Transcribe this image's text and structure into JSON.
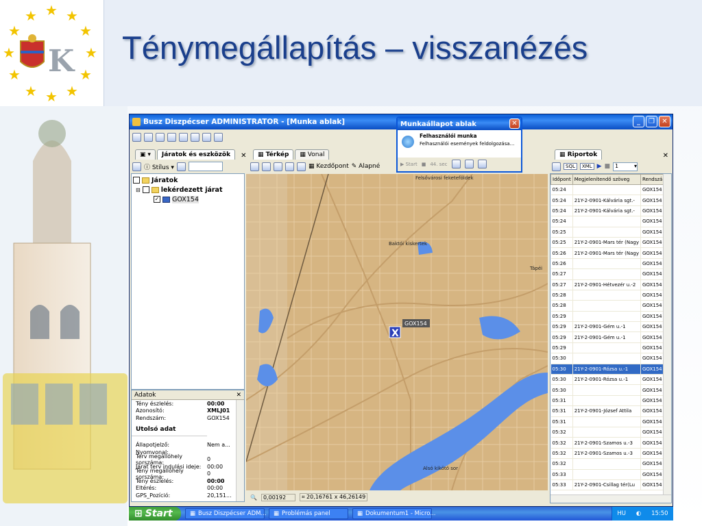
{
  "slide": {
    "title": "Ténymegállapítás – visszanézés",
    "logo_text": "K"
  },
  "app": {
    "window_title": "Busz Diszpécser ADMINISTRATOR - [Munka ablak]",
    "left_tabs": [
      "Járatok és eszközök"
    ],
    "left_toolbar": {
      "style_label": "Stílus"
    },
    "tree": {
      "root": "Járatok",
      "child": "lekérdezett járat",
      "vehicle": "GOX154"
    },
    "data_panel": {
      "title": "Adatok",
      "rows_top": [
        {
          "k": "Tény észlelés:",
          "v": "00:00"
        },
        {
          "k": "Azonosító:",
          "v": "XMLJ01"
        },
        {
          "k": "Rendszám:",
          "v": "GOX154"
        }
      ],
      "section": "Utolsó adat",
      "rows_bottom": [
        {
          "k": "Állapotjelző:",
          "v": "Nem a..."
        },
        {
          "k": "Nyomvonal:",
          "v": ""
        },
        {
          "k": "Terv megállóhely sorszáma:",
          "v": "0"
        },
        {
          "k": "Járat terv indulási ideje:",
          "v": "00:00"
        },
        {
          "k": "Tény megállóhely sorszáma:",
          "v": "0"
        },
        {
          "k": "Tény észlelés:",
          "v": "00:00"
        },
        {
          "k": "Eltérés:",
          "v": "00:00"
        },
        {
          "k": "GPS_Pozíció:",
          "v": "20,151..."
        }
      ]
    },
    "map_tabs": [
      "Térkép",
      "Vonal"
    ],
    "map_toolbar": {
      "start_point": "Kezdőpont",
      "base": "Alapné"
    },
    "map_labels": {
      "top": "Felsővárosi feketeföldek",
      "garden": "Baktói kiskertek",
      "east": "Tápéi",
      "bottom": "Alsó kikötő sor",
      "vehicle": "GOX154",
      "marker": "X"
    },
    "map_status": {
      "scale": "0,00192",
      "coords": "20,16761 x 46,26149"
    },
    "report": {
      "tab": "Riportok",
      "toolbar": {
        "sql": "SQL",
        "xml": "XML",
        "page": "1"
      },
      "columns": [
        "Időpont",
        "Megjelenítendő szöveg",
        "Rendszám"
      ],
      "rows": [
        [
          "05:24",
          "",
          "GOX154"
        ],
        [
          "05:24",
          "21Y-2-0901-Kálvária sgt.-",
          "GOX154"
        ],
        [
          "05:24",
          "21Y-2-0901-Kálvária sgt.-",
          "GOX154"
        ],
        [
          "05:24",
          "",
          "GOX154"
        ],
        [
          "05:25",
          "",
          "GOX154"
        ],
        [
          "05:25",
          "21Y-2-0901-Mars tér (Nagy",
          "GOX154"
        ],
        [
          "05:26",
          "21Y-2-0901-Mars tér (Nagy",
          "GOX154"
        ],
        [
          "05:26",
          "",
          "GOX154"
        ],
        [
          "05:27",
          "",
          "GOX154"
        ],
        [
          "05:27",
          "21Y-2-0901-Hétvezér u.-2",
          "GOX154"
        ],
        [
          "05:28",
          "",
          "GOX154"
        ],
        [
          "05:28",
          "",
          "GOX154"
        ],
        [
          "05:29",
          "",
          "GOX154"
        ],
        [
          "05:29",
          "21Y-2-0901-Gém u.-1",
          "GOX154"
        ],
        [
          "05:29",
          "21Y-2-0901-Gém u.-1",
          "GOX154"
        ],
        [
          "05:29",
          "",
          "GOX154"
        ],
        [
          "05:30",
          "",
          "GOX154"
        ],
        [
          "05:30",
          "21Y-2-0901-Rózsa u.-1",
          "GOX154"
        ],
        [
          "05:30",
          "21Y-2-0901-Rózsa u.-1",
          "GOX154"
        ],
        [
          "05:30",
          "",
          "GOX154"
        ],
        [
          "05:31",
          "",
          "GOX154"
        ],
        [
          "05:31",
          "21Y-2-0901-József Attila",
          "GOX154"
        ],
        [
          "05:31",
          "",
          "GOX154"
        ],
        [
          "05:32",
          "",
          "GOX154"
        ],
        [
          "05:32",
          "21Y-2-0901-Szamos u.-3",
          "GOX154"
        ],
        [
          "05:32",
          "21Y-2-0901-Szamos u.-3",
          "GOX154"
        ],
        [
          "05:32",
          "",
          "GOX154"
        ],
        [
          "05:33",
          "",
          "GOX154"
        ],
        [
          "05:33",
          "21Y-2-0901-Csillag tér(Lu",
          "GOX154"
        ]
      ],
      "selected_index": 17
    },
    "popup": {
      "title": "Munkaállapot ablak",
      "heading": "Felhasználói munka",
      "subtext": "Felhasználói események feldolgozása...",
      "start": "Start",
      "seconds": "44. sec"
    }
  },
  "taskbar": {
    "start": "Start",
    "tasks": [
      "Busz Diszpécser ADM...",
      "Problémás panel",
      "Dokumentum1 - Micro..."
    ],
    "lang": "HU",
    "clock": "15:50"
  },
  "colors": {
    "title": "#1a3f8c",
    "xp_blue": "#0a5fd8",
    "selected_row": "#316ac5",
    "map_ground": "#d6b582",
    "river": "#5b8fe8"
  }
}
